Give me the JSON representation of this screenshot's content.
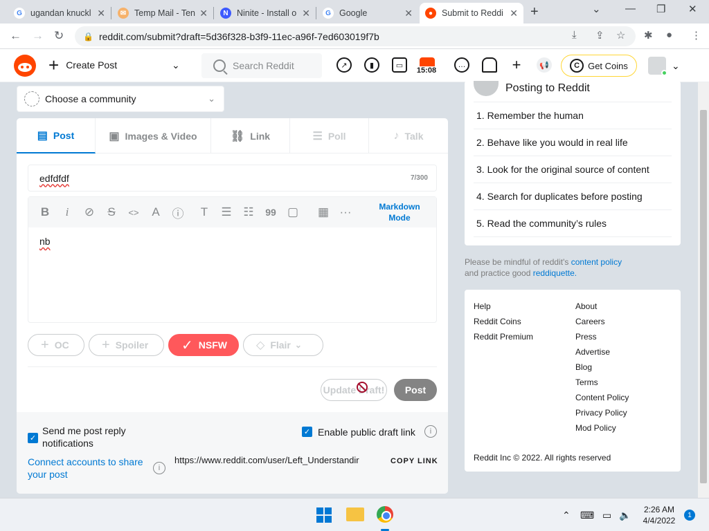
{
  "browser": {
    "tabs": [
      {
        "title": "ugandan knuckl",
        "color": "#4285f4",
        "letter": "G"
      },
      {
        "title": "Temp Mail - Ten",
        "color": "#f6b26b",
        "letter": "✉"
      },
      {
        "title": "Ninite - Install o",
        "color": "#3d5afe",
        "letter": "N"
      },
      {
        "title": "Google",
        "color": "#4285f4",
        "letter": "G"
      },
      {
        "title": "Submit to Reddi",
        "color": "#ff4500",
        "letter": "r"
      }
    ],
    "new_tab": "+",
    "url": "reddit.com/submit?draft=5d36f328-b3f9-11ec-a96f-7ed603019f7b"
  },
  "header": {
    "create_post": "Create Post",
    "search_placeholder": "Search Reddit",
    "timer_badge": "15:08",
    "get_coins": "Get Coins"
  },
  "community": {
    "placeholder": "Choose a community"
  },
  "post": {
    "tabs": [
      {
        "label": "Post",
        "icon": "▤"
      },
      {
        "label": "Images & Video",
        "icon": "🖼"
      },
      {
        "label": "Link",
        "icon": "🔗"
      },
      {
        "label": "Poll",
        "icon": "☰"
      },
      {
        "label": "Talk",
        "icon": "🎙"
      }
    ],
    "title_value": "edfdfdf",
    "title_count": "7/300",
    "toolbar_icons": [
      "B",
      "i",
      "🔗",
      "S",
      "<>",
      "A",
      "ⓘ",
      "T",
      "☰",
      "☷",
      "99",
      "▢",
      "▦",
      "···"
    ],
    "markdown_mode": "Markdown Mode",
    "body_value": "nb",
    "tags": [
      {
        "label": "OC",
        "icon": "+"
      },
      {
        "label": "Spoiler",
        "icon": "+"
      },
      {
        "label": "NSFW",
        "icon": "✓"
      },
      {
        "label": "Flair",
        "icon": "◇"
      }
    ],
    "update_button": "Update Draft!",
    "post_button": "Post",
    "reply_notifications": "Send me post reply notifications",
    "public_draft": "Enable public draft link",
    "connect_accounts": "Connect accounts to share your post",
    "draft_url": "https://www.reddit.com/user/Left_Understandir",
    "copy_link": "COPY LINK"
  },
  "sidebar": {
    "posting_title": "Posting to Reddit",
    "rules": [
      "1. Remember the human",
      "2. Behave like you would in real life",
      "3. Look for the original source of content",
      "4. Search for duplicates before posting",
      "5. Read the community’s rules"
    ],
    "mindful_prefix": "Please be mindful of reddit's",
    "content_policy": "content policy",
    "mindful_mid": "and practice good",
    "reddiquette": "reddiquette.",
    "links_left": [
      "Help",
      "Reddit Coins",
      "Reddit Premium"
    ],
    "links_right": [
      "About",
      "Careers",
      "Press",
      "Advertise",
      "Blog",
      "Terms",
      "Content Policy",
      "Privacy Policy",
      "Mod Policy"
    ],
    "copyright": "Reddit Inc © 2022. All rights reserved"
  },
  "taskbar": {
    "time": "2:26 AM",
    "date": "4/4/2022",
    "notifications": "1"
  }
}
